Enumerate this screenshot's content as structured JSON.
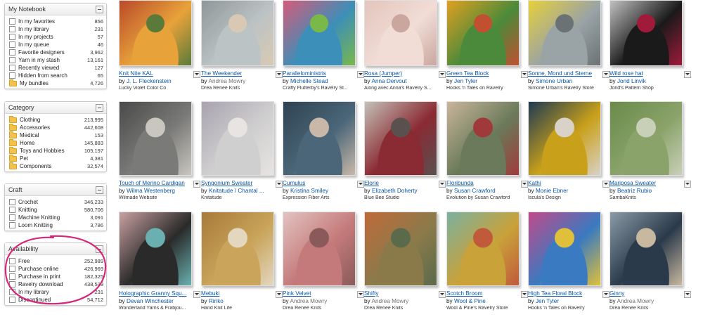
{
  "sidebar": {
    "notebook": {
      "title": "My Notebook",
      "items": [
        {
          "label": "In my favorites",
          "count": "856"
        },
        {
          "label": "In my library",
          "count": "231"
        },
        {
          "label": "In my projects",
          "count": "57"
        },
        {
          "label": "In my queue",
          "count": "46"
        },
        {
          "label": "Favorite designers",
          "count": "3,962"
        },
        {
          "label": "Yarn in my stash",
          "count": "13,161"
        },
        {
          "label": "Recently viewed",
          "count": "127"
        },
        {
          "label": "Hidden from search",
          "count": "65"
        },
        {
          "label": "My bundles",
          "count": "4,726",
          "icon": "folder-icon"
        }
      ]
    },
    "category": {
      "title": "Category",
      "items": [
        {
          "label": "Clothing",
          "count": "213,995"
        },
        {
          "label": "Accessories",
          "count": "442,608"
        },
        {
          "label": "Medical",
          "count": "153"
        },
        {
          "label": "Home",
          "count": "145,883"
        },
        {
          "label": "Toys and Hobbies",
          "count": "105,197"
        },
        {
          "label": "Pet",
          "count": "4,381"
        },
        {
          "label": "Components",
          "count": "32,574"
        }
      ]
    },
    "craft": {
      "title": "Craft",
      "items": [
        {
          "label": "Crochet",
          "count": "346,233"
        },
        {
          "label": "Knitting",
          "count": "580,706"
        },
        {
          "label": "Machine Knitting",
          "count": "3,091"
        },
        {
          "label": "Loom Knitting",
          "count": "3,786"
        }
      ]
    },
    "availability": {
      "title": "Availability",
      "items": [
        {
          "label": "Free",
          "count": "252,989"
        },
        {
          "label": "Purchase online",
          "count": "426,969"
        },
        {
          "label": "Purchase in print",
          "count": "182,325"
        },
        {
          "label": "Ravelry download",
          "count": "438,539"
        },
        {
          "label": "In my library",
          "count": "231"
        },
        {
          "label": "Discontinued",
          "count": "54,712"
        }
      ],
      "annotation_color": "#d6257a"
    }
  },
  "patterns": [
    {
      "title": "Knit Nite KAL",
      "by": "by",
      "designer": "J. L. Fleckenstein",
      "designer_style": "link",
      "source": "Lucky Violet Color Co",
      "colors": [
        "#e8a23a",
        "#b84a2a",
        "#5a7a3a"
      ]
    },
    {
      "title": "The Weekender",
      "by": "by",
      "designer": "Andrea Mowry",
      "designer_style": "alt",
      "source": "Drea Renee Knits",
      "colors": [
        "#bcc3c4",
        "#8e9799",
        "#d9c9b4"
      ]
    },
    {
      "title": "Paralleloministris",
      "by": "by",
      "designer": "Michelle Stead",
      "designer_style": "link",
      "source": "Crafty Flutterby's Ravelry St...",
      "colors": [
        "#3c8fb8",
        "#d65a7a",
        "#7ab84a"
      ]
    },
    {
      "title": "Rosa (Jumper)",
      "by": "by",
      "designer": "Anna Dervout",
      "designer_style": "link",
      "source": "Along avec Anna's Ravelry S...",
      "colors": [
        "#f1ddd6",
        "#e3c5bd",
        "#c9a79f"
      ]
    },
    {
      "title": "Green Tea Block",
      "by": "by",
      "designer": "Jen Tyler",
      "designer_style": "link",
      "source": "Hooks 'n Tales on Ravelry",
      "colors": [
        "#4a8a3a",
        "#e0a020",
        "#c05030"
      ]
    },
    {
      "title": "Sonne, Mond und Sterne",
      "by": "by",
      "designer": "Simone Urban",
      "designer_style": "link",
      "source": "Simone Urban's Ravelry Store",
      "colors": [
        "#9aa3a6",
        "#e6d03a",
        "#6a7274"
      ]
    },
    {
      "title": "Wild rose hat",
      "by": "by",
      "designer": "Jorid Linvik",
      "designer_style": "link",
      "source": "Jorid's Pattern Shop",
      "colors": [
        "#1a1a1a",
        "#c0c0c0",
        "#a01a3a"
      ]
    },
    {
      "title": "Touch of Merino Cardigan",
      "by": "by",
      "designer": "Wilma Westenberg",
      "designer_style": "link",
      "source": "Wilmade Website",
      "colors": [
        "#7a7a78",
        "#4a4a4a",
        "#c9c6c0"
      ]
    },
    {
      "title": "Syngonium Sweater",
      "by": "by",
      "designer": "Knitatude / Chantal ...",
      "designer_style": "link",
      "source": "Knitatude",
      "colors": [
        "#d0cfcf",
        "#a8a3b0",
        "#e7e4e2"
      ]
    },
    {
      "title": "Cumulus",
      "by": "by",
      "designer": "Kristina Smiley",
      "designer_style": "link",
      "source": "Expression Fiber Arts",
      "colors": [
        "#4a6678",
        "#2f4352",
        "#c9b8a8"
      ]
    },
    {
      "title": "Elorie",
      "by": "by",
      "designer": "Elizabeth Doherty",
      "designer_style": "link",
      "source": "Blue Bee Studio",
      "colors": [
        "#8a2a32",
        "#c5c0b8",
        "#5a5050"
      ]
    },
    {
      "title": "Floribunda",
      "by": "by",
      "designer": "Susan Crawford",
      "designer_style": "link",
      "source": "Evolution by Susan Crawford",
      "colors": [
        "#6a7a5a",
        "#c9b59a",
        "#a03a3a"
      ]
    },
    {
      "title": "Kathi",
      "by": "by",
      "designer": "Monie Ebner",
      "designer_style": "link",
      "source": "Iscula's Design",
      "colors": [
        "#c9a01a",
        "#1e3a52",
        "#d8d2c8"
      ]
    },
    {
      "title": "Mariposa Sweater",
      "by": "by",
      "designer": "Beatriz Rubio",
      "designer_style": "link",
      "source": "SambaKnits",
      "colors": [
        "#8aa36a",
        "#6a8a4a",
        "#c9d0b8"
      ]
    },
    {
      "title": "Holographic Granny Squ...",
      "by": "by",
      "designer": "Devan Winchester",
      "designer_style": "link",
      "source": "Wonderland Yarns & Frabjou...",
      "colors": [
        "#2a2a2a",
        "#c9a0a0",
        "#6ab0b0"
      ]
    },
    {
      "title": "Mebuki",
      "by": "by",
      "designer": "Ririko",
      "designer_style": "link",
      "source": "Hand Knit Life",
      "colors": [
        "#c9a45a",
        "#a87a3a",
        "#e3d7c0"
      ]
    },
    {
      "title": "Pink Velvet",
      "by": "by",
      "designer": "Andrea Mowry",
      "designer_style": "alt",
      "source": "Drea Renee Knits",
      "colors": [
        "#c47a7a",
        "#e2c3c0",
        "#8a5a5a"
      ]
    },
    {
      "title": "Shifty",
      "by": "by",
      "designer": "Andrea Mowry",
      "designer_style": "alt",
      "source": "Drea Renee Knits",
      "colors": [
        "#8a7a4a",
        "#c06a3a",
        "#5a6a4a"
      ]
    },
    {
      "title": "Scotch Broom",
      "by": "by",
      "designer": "Wool & Pine",
      "designer_style": "link",
      "source": "Wool & Pine's Ravelry Store",
      "colors": [
        "#c9a23a",
        "#7ab0a0",
        "#c05a3a"
      ]
    },
    {
      "title": "High Tea Floral Block",
      "by": "by",
      "designer": "Jen Tyler",
      "designer_style": "link",
      "source": "Hooks 'n Tales on Ravelry",
      "colors": [
        "#3a7ac0",
        "#c04a8a",
        "#e0c03a"
      ]
    },
    {
      "title": "Ginny",
      "by": "by",
      "designer": "Andrea Mowry",
      "designer_style": "alt",
      "source": "Drea Renee Knits",
      "colors": [
        "#2a3a4a",
        "#8a9aa6",
        "#c9b8a0"
      ]
    }
  ]
}
